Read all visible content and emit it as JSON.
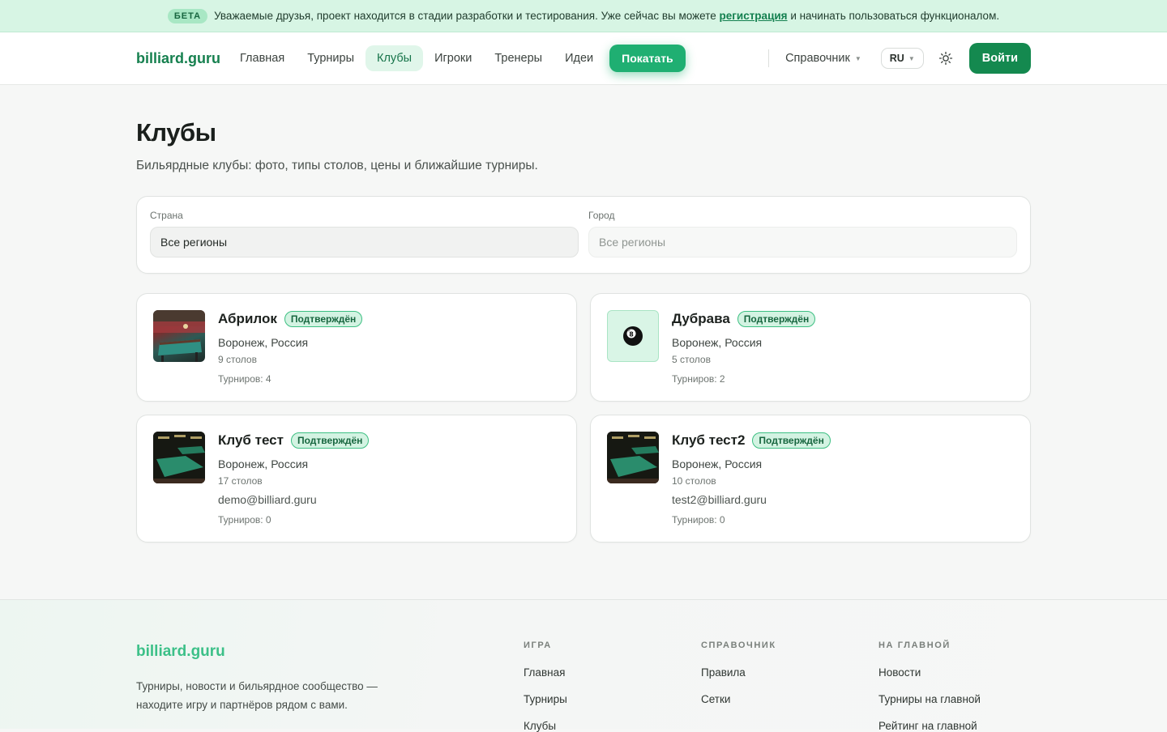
{
  "banner": {
    "badge": "БЕТА",
    "text_before": "Уважаемые друзья, проект находится в стадии разработки и тестирования. Уже сейчас вы можете",
    "link": "регистрация",
    "text_after": "и начинать пользоваться функционалом."
  },
  "header": {
    "logo": "billiard.guru",
    "nav": [
      "Главная",
      "Турниры",
      "Клубы",
      "Игроки",
      "Тренеры",
      "Идеи"
    ],
    "active_nav": "Клубы",
    "play_button": "Покатать",
    "reference": "Справочник",
    "language": "RU",
    "login": "Войти"
  },
  "page": {
    "title": "Клубы",
    "subtitle": "Бильярдные клубы: фото, типы столов, цены и ближайшие турниры."
  },
  "filters": {
    "country_label": "Страна",
    "country_value": "Все регионы",
    "city_label": "Город",
    "city_value": "Все регионы"
  },
  "clubs": [
    {
      "name": "Абрилок",
      "badge": "Подтверждён",
      "location": "Воронеж, Россия",
      "tables": "9 столов",
      "email": "",
      "tournaments": "Турниров: 4",
      "image": "photo"
    },
    {
      "name": "Дубрава",
      "badge": "Подтверждён",
      "location": "Воронеж, Россия",
      "tables": "5 столов",
      "email": "",
      "tournaments": "Турниров: 2",
      "image": "8-ball-icon"
    },
    {
      "name": "Клуб тест",
      "badge": "Подтверждён",
      "location": "Воронеж, Россия",
      "tables": "17 столов",
      "email": "demo@billiard.guru",
      "tournaments": "Турниров: 0",
      "image": "photo"
    },
    {
      "name": "Клуб тест2",
      "badge": "Подтверждён",
      "location": "Воронеж, Россия",
      "tables": "10 столов",
      "email": "test2@billiard.guru",
      "tournaments": "Турниров: 0",
      "image": "photo"
    }
  ],
  "footer": {
    "logo": "billiard.guru",
    "description": "Турниры, новости и бильярдное сообщество — находите игру и партнёров рядом с вами.",
    "columns": [
      {
        "title": "ИГРА",
        "links": [
          "Главная",
          "Турниры",
          "Клубы"
        ]
      },
      {
        "title": "СПРАВОЧНИК",
        "links": [
          "Правила",
          "Сетки"
        ]
      },
      {
        "title": "НА ГЛАВНОЙ",
        "links": [
          "Новости",
          "Турниры на главной",
          "Рейтинг на главной"
        ]
      }
    ]
  },
  "colors": {
    "accent": "#1faf72",
    "brand": "#16804f",
    "banner": "#d7f5e4"
  }
}
